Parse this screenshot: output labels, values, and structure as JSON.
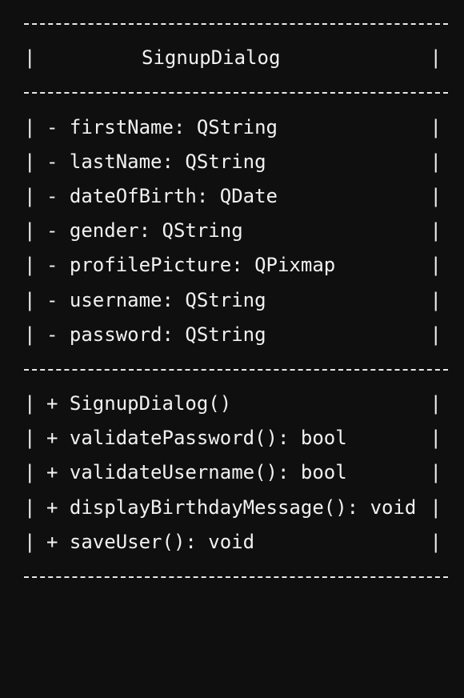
{
  "class_name": "SignupDialog",
  "attributes": [
    "- firstName: QString",
    "- lastName: QString",
    "- dateOfBirth: QDate",
    "- gender: QString",
    "- profilePicture: QPixmap",
    "- username: QString",
    "- password: QString"
  ],
  "methods": [
    "+ SignupDialog()",
    "+ validatePassword(): bool",
    "+ validateUsername(): bool",
    "+ displayBirthdayMessage(): void",
    "+ saveUser(): void"
  ],
  "border_char": "|",
  "colors": {
    "background": "#0f0f0f",
    "text": "#f1f1f1"
  }
}
